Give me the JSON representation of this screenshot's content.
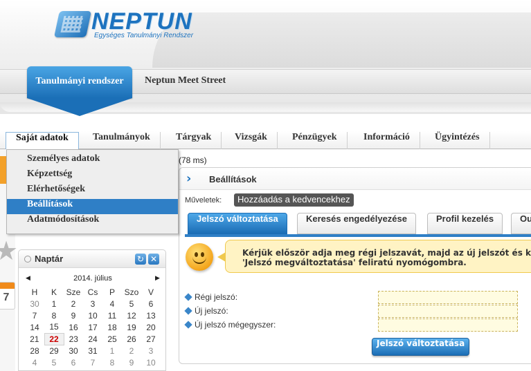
{
  "logo": {
    "name": "NEPTUN",
    "subtitle": "Egységes Tanulmányi Rendszer"
  },
  "header": {
    "active_module": "Tanulmányi rendszer",
    "other_module": "Neptun Meet Street"
  },
  "menu": {
    "items": [
      "Saját adatok",
      "Tanulmányok",
      "Tárgyak",
      "Vizsgák",
      "Pénzügyek",
      "Információ",
      "Ügyintézés"
    ],
    "active": "Saját adatok"
  },
  "dropdown": {
    "items": [
      "Személyes adatok",
      "Képzettség",
      "Elérhetőségek",
      "Beállítások",
      "Adatmódosítások"
    ],
    "selected": "Beállítások"
  },
  "load_time": "(78 ms)",
  "calendar": {
    "title": "Naptár",
    "month_label": "2014. július",
    "weekdays": [
      "H",
      "K",
      "Sze",
      "Cs",
      "P",
      "Szo",
      "V"
    ],
    "today": "22",
    "rows": [
      [
        "30",
        "1",
        "2",
        "3",
        "4",
        "5",
        "6"
      ],
      [
        "7",
        "8",
        "9",
        "10",
        "11",
        "12",
        "13"
      ],
      [
        "14",
        "15",
        "16",
        "17",
        "18",
        "19",
        "20"
      ],
      [
        "21",
        "22",
        "23",
        "24",
        "25",
        "26",
        "27"
      ],
      [
        "28",
        "29",
        "30",
        "31",
        "1",
        "2",
        "3"
      ],
      [
        "4",
        "5",
        "6",
        "7",
        "8",
        "9",
        "10"
      ]
    ]
  },
  "content": {
    "title": "Beállítások",
    "actions_label": "Műveletek:",
    "favorite_button": "Hozzáadás a kedvencekhez",
    "tabs": [
      "Jelszó változtatása",
      "Keresés engedélyezése",
      "Profil kezelés",
      "Ou"
    ],
    "active_tab": "Jelszó változtatása",
    "message_line1": "Kérjük először adja meg régi jelszavát, majd az új jelszót és ka",
    "message_line2": "'Jelszó megváltoztatása' feliratú nyomógombra.",
    "fields": [
      {
        "label": "Régi jelszó:",
        "value": ""
      },
      {
        "label": "Új jelszó:",
        "value": ""
      },
      {
        "label": "Új jelszó mégegyszer:",
        "value": ""
      }
    ],
    "submit_button": "Jelszó változtatása"
  },
  "colors": {
    "brand_blue": "#1d73bf",
    "selected_blue": "#2f7fc6",
    "message_bg": "#fff3c4",
    "input_bg": "#fffce1"
  }
}
